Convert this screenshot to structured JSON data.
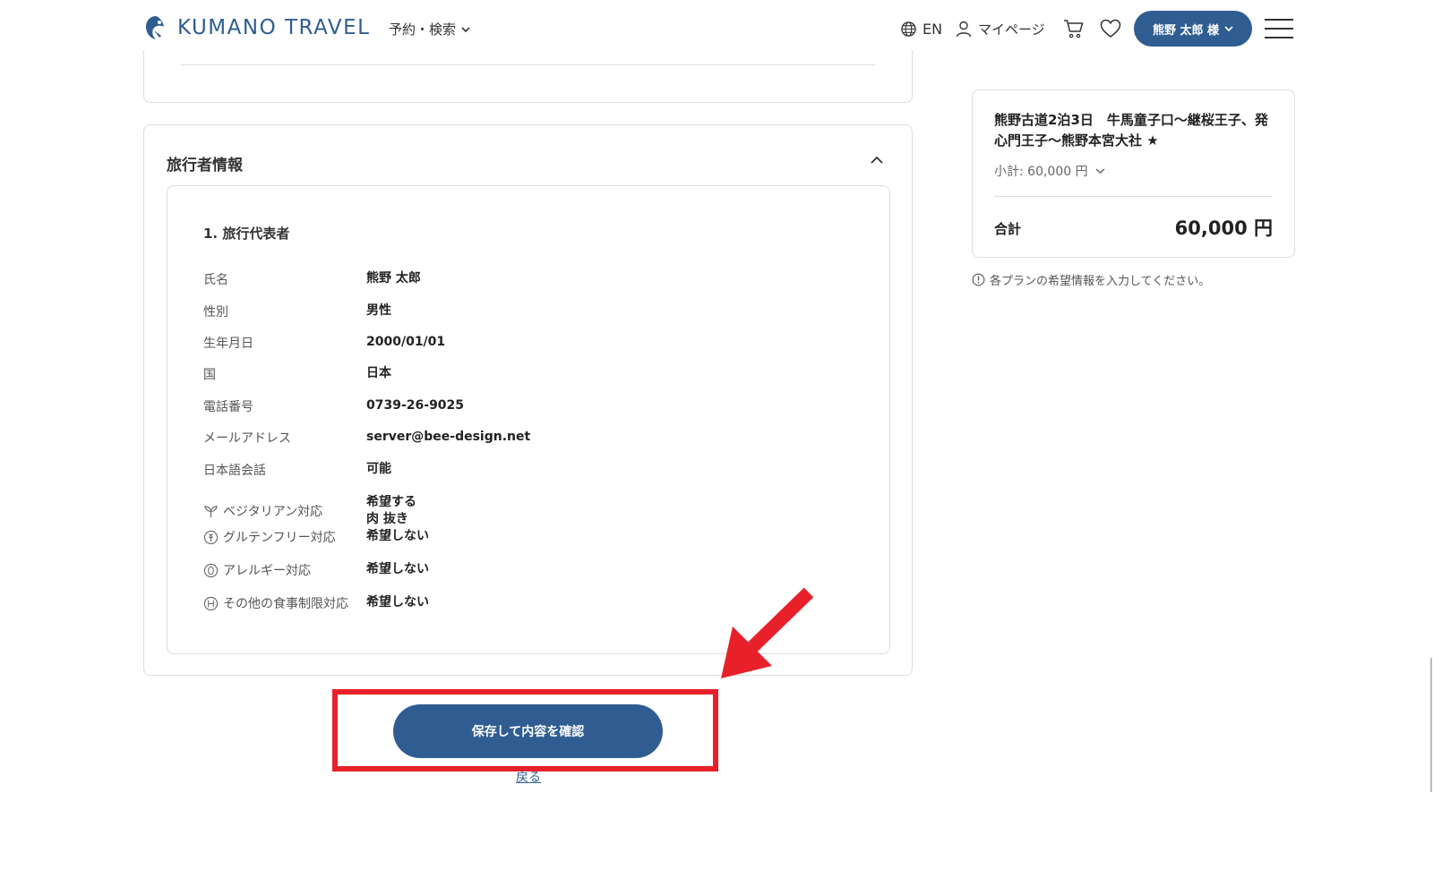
{
  "header": {
    "logo_text": "KUMANO TRAVEL",
    "nav_search": "予約・検索",
    "lang": "EN",
    "mypage": "マイページ",
    "user": "熊野 太郎 様"
  },
  "traveler": {
    "section_title": "旅行者情報",
    "rep_title": "1. 旅行代表者",
    "rows": [
      {
        "label": "氏名",
        "value": "熊野 太郎"
      },
      {
        "label": "性別",
        "value": "男性"
      },
      {
        "label": "生年月日",
        "value": "2000/01/01"
      },
      {
        "label": "国",
        "value": "日本"
      },
      {
        "label": "電話番号",
        "value": "0739-26-9025"
      },
      {
        "label": "メールアドレス",
        "value": "server@bee-design.net"
      },
      {
        "label": "日本語会話",
        "value": "可能"
      }
    ],
    "diet": [
      {
        "label": "ベジタリアン対応",
        "value": "希望する",
        "value2": "肉 抜き",
        "icon": "leaf-icon"
      },
      {
        "label": "グルテンフリー対応",
        "value": "希望しない",
        "icon": "wheat-icon"
      },
      {
        "label": "アレルギー対応",
        "value": "希望しない",
        "icon": "allergy-icon"
      },
      {
        "label": "その他の食事制限対応",
        "value": "希望しない",
        "icon": "other-diet-icon"
      }
    ]
  },
  "actions": {
    "save": "保存して内容を確認",
    "back": "戻る"
  },
  "summary": {
    "plan_title": "熊野古道2泊3日　牛馬童子口〜継桜王子、発心門王子〜熊野本宮大社 ★",
    "subtotal": "小計: 60,000 円",
    "total_label": "合計",
    "total_value": "60,000 円",
    "notice": "各プランの希望情報を入力してください。"
  },
  "colors": {
    "brand": "#2f5d92",
    "highlight": "#e8202a"
  }
}
